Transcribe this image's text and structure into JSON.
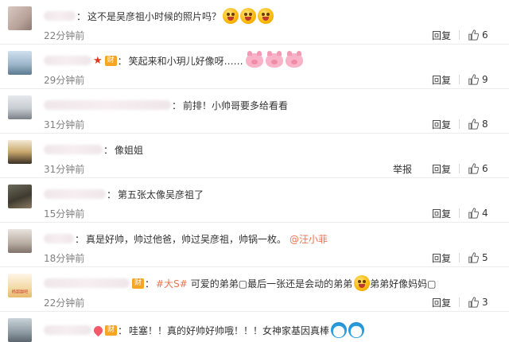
{
  "comments": [
    {
      "time": "22分钟前",
      "body": "这不是吴彦祖小时候的照片吗？",
      "emojis": [
        "tongue-emoji",
        "tongue-emoji",
        "tongue-emoji"
      ],
      "reply_label": "回复",
      "likes": "6"
    },
    {
      "time": "29分钟前",
      "body": "笑起来和小玥儿好像呀……",
      "emojis": [
        "pig-emoji",
        "pig-emoji",
        "pig-emoji"
      ],
      "reply_label": "回复",
      "likes": "9"
    },
    {
      "time": "31分钟前",
      "body": "前排！小帅哥要多给看看",
      "reply_label": "回复",
      "likes": "8"
    },
    {
      "time": "31分钟前",
      "body": "像姐姐",
      "report_label": "举报",
      "reply_label": "回复",
      "likes": "6"
    },
    {
      "time": "15分钟前",
      "body": "第五张太像吴彦祖了",
      "reply_label": "回复",
      "likes": "4"
    },
    {
      "time": "18分钟前",
      "body": "真是好帅，帅过他爸，帅过吴彦祖，帅锅一枚。",
      "mention": "@汪小菲",
      "reply_label": "回复",
      "likes": "5"
    },
    {
      "avatar_text": "杨超越吧",
      "time": "22分钟前",
      "topic": "#大S#",
      "body_a": "可爱的弟弟▢最后一张还是会动的弟弟",
      "body_b": "弟弟好像妈妈▢",
      "reply_label": "回复",
      "likes": "3"
    },
    {
      "body": "哇塞！！真的好帅好帅哦！！！女神家基因真棒",
      "emojis": [
        "doraemon-emoji",
        "doraemon-emoji"
      ]
    }
  ],
  "badges": {
    "vip_label": "财"
  },
  "colors": {
    "link": "#eb7350",
    "time": "#808080",
    "text": "#333333"
  },
  "icons": {
    "like": "thumbs-up-icon",
    "star": "star-icon",
    "vip": "vip-badge-icon"
  }
}
